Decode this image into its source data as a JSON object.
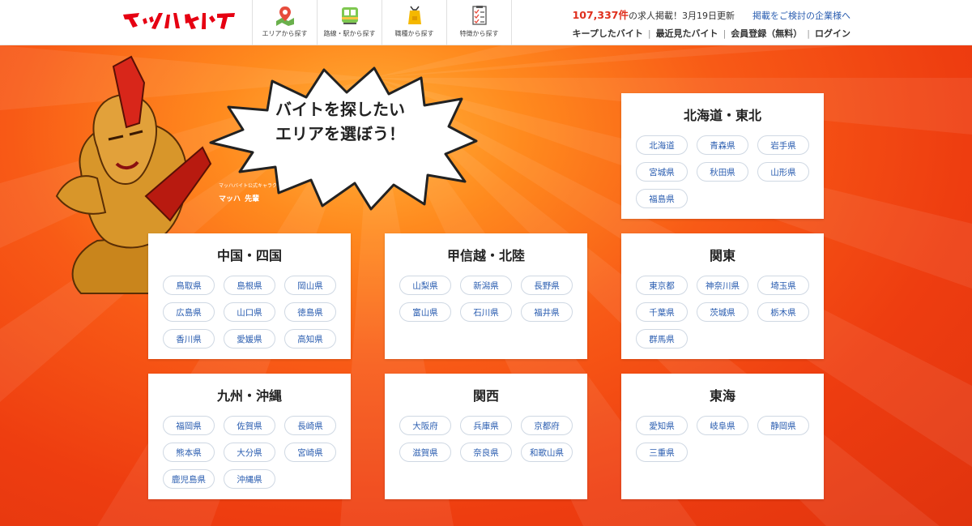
{
  "header": {
    "logo_text": "マッハバイト",
    "nav": [
      {
        "label": "エリアから探す",
        "icon": "map-pin-icon"
      },
      {
        "label": "路線・駅から探す",
        "icon": "train-icon"
      },
      {
        "label": "職種から探す",
        "icon": "apron-icon"
      },
      {
        "label": "特徴から探す",
        "icon": "checklist-icon"
      }
    ],
    "stats": {
      "count": "107,337件",
      "text": "の求人掲載！3月19日更新"
    },
    "biz_link": "掲載をご検討の企業様へ",
    "links": [
      "キープしたバイト",
      "最近見たバイト",
      "会員登録（無料）",
      "ログイン"
    ]
  },
  "hero": {
    "bubble_lines": [
      "バイトを探したい",
      "エリアを選ぼう！"
    ],
    "mascot_caption_small": "マッハバイト公式キャラクター",
    "mascot_caption_logo": "マッハ",
    "mascot_caption_title": "先輩"
  },
  "regions": [
    {
      "name": "北海道・東北",
      "prefectures": [
        "北海道",
        "青森県",
        "岩手県",
        "宮城県",
        "秋田県",
        "山形県",
        "福島県"
      ]
    },
    {
      "name": "中国・四国",
      "prefectures": [
        "鳥取県",
        "島根県",
        "岡山県",
        "広島県",
        "山口県",
        "徳島県",
        "香川県",
        "愛媛県",
        "高知県"
      ]
    },
    {
      "name": "甲信越・北陸",
      "prefectures": [
        "山梨県",
        "新潟県",
        "長野県",
        "富山県",
        "石川県",
        "福井県"
      ]
    },
    {
      "name": "関東",
      "prefectures": [
        "東京都",
        "神奈川県",
        "埼玉県",
        "千葉県",
        "茨城県",
        "栃木県",
        "群馬県"
      ]
    },
    {
      "name": "九州・沖縄",
      "prefectures": [
        "福岡県",
        "佐賀県",
        "長崎県",
        "熊本県",
        "大分県",
        "宮崎県",
        "鹿児島県",
        "沖縄県"
      ]
    },
    {
      "name": "関西",
      "prefectures": [
        "大阪府",
        "兵庫県",
        "京都府",
        "滋賀県",
        "奈良県",
        "和歌山県"
      ]
    },
    {
      "name": "東海",
      "prefectures": [
        "愛知県",
        "岐阜県",
        "静岡県",
        "三重県"
      ]
    }
  ],
  "colors": {
    "brand": "#e0301e",
    "link": "#2a5db0",
    "hero_bg": "#ee3d10"
  }
}
